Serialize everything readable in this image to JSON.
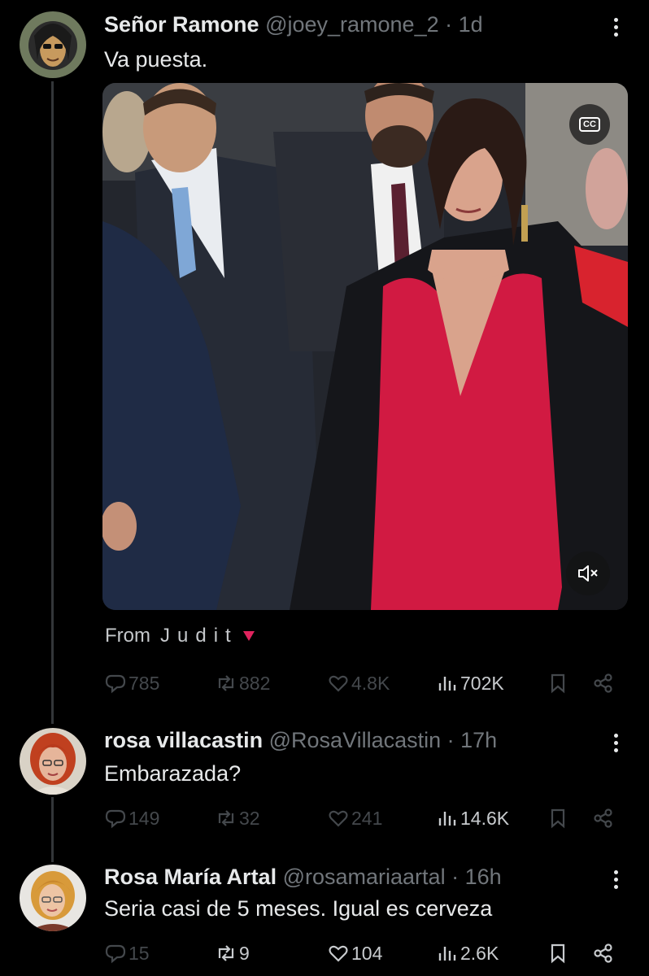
{
  "tweets": [
    {
      "name": "Señor Ramone",
      "handle": "@joey_ramone_2",
      "time": "· 1d",
      "text": "Va puesta.",
      "media": {
        "cc_label": "CC",
        "attribution_label": "From",
        "attribution_source": "Judit"
      },
      "stats": {
        "replies": "785",
        "reposts": "882",
        "likes": "4.8K",
        "views": "702K"
      }
    },
    {
      "name": "rosa villacastin",
      "handle": "@RosaVillacastin",
      "time": "· 17h",
      "text": "Embarazada?",
      "stats": {
        "replies": "149",
        "reposts": "32",
        "likes": "241",
        "views": "14.6K"
      }
    },
    {
      "name": "Rosa María Artal",
      "handle": "@rosamariaartal",
      "time": "· 16h",
      "text": "Seria casi de 5 meses. Igual es cerveza",
      "stats": {
        "replies": "15",
        "reposts": "9",
        "likes": "104",
        "views": "2.6K"
      }
    }
  ],
  "icons": {
    "reply": "speech-bubble-icon",
    "repost": "repost-arrows-icon",
    "like": "heart-icon",
    "views": "bar-chart-icon",
    "bookmark": "bookmark-icon",
    "share": "share-icon",
    "more": "vertical-ellipsis-icon",
    "mute": "speaker-muted-icon",
    "captions": "closed-captions-icon"
  },
  "colors": {
    "background": "#000000",
    "text": "#e7e9ea",
    "secondary": "#71767b",
    "dress": "#d11a42",
    "attribution_arrow": "#e0245e"
  }
}
